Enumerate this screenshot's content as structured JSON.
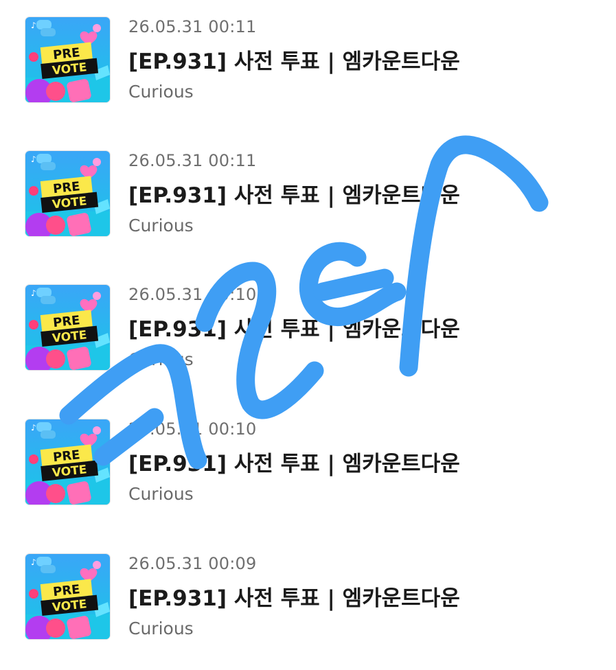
{
  "notifications": [
    {
      "date": "26.05.31 00:11",
      "title": "[EP.931] 사전 투표 | 엠카운트다운",
      "artist": "Curious",
      "thumb_badge": [
        "PRE",
        "VOTE"
      ]
    },
    {
      "date": "26.05.31 00:11",
      "title": "[EP.931] 사전 투표 | 엠카운트다운",
      "artist": "Curious",
      "thumb_badge": [
        "PRE",
        "VOTE"
      ]
    },
    {
      "date": "26.05.31 00:10",
      "title": "[EP.931] 사전 투표 | 엠카운트다운",
      "artist": "Curious",
      "thumb_badge": [
        "PRE",
        "VOTE"
      ]
    },
    {
      "date": "26.05.31 00:10",
      "title": "[EP.931] 사전 투표 | 엠카운트다운",
      "artist": "Curious",
      "thumb_badge": [
        "PRE",
        "VOTE"
      ]
    },
    {
      "date": "26.05.31 00:09",
      "title": "[EP.931] 사전 투표 | 엠카운트다운",
      "artist": "Curious",
      "thumb_badge": [
        "PRE",
        "VOTE"
      ]
    }
  ],
  "colors": {
    "thumb_bg": "#2f9df5",
    "badge_yellow": "#fbe84a",
    "badge_black": "#111111",
    "scribble": "#3f9ef4"
  }
}
